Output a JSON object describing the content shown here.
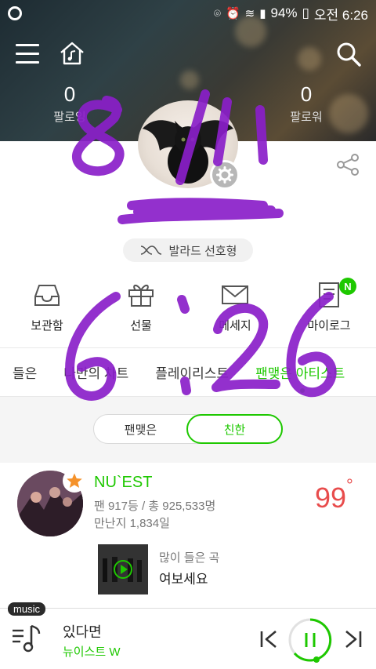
{
  "status_bar": {
    "battery": "94%",
    "time": "오전 6:26"
  },
  "header": {
    "following_count": "0",
    "following_label": "팔로잉",
    "followers_count": "0",
    "followers_label": "팔로워"
  },
  "profile": {
    "tag": "발라드 선호형"
  },
  "actions": [
    {
      "label": "보관함",
      "icon": "inbox-tray-icon"
    },
    {
      "label": "선물",
      "icon": "gift-icon"
    },
    {
      "label": "메세지",
      "icon": "mail-icon"
    },
    {
      "label": "마이로그",
      "icon": "document-icon",
      "badge": "N"
    }
  ],
  "tabs": [
    "들은",
    "나만의 차트",
    "플레이리스트",
    "팬맺은 아티스트"
  ],
  "active_tab": "팬맺은 아티스트",
  "segment": {
    "options": [
      "팬맺은",
      "친한"
    ],
    "selected": "친한"
  },
  "artist": {
    "name": "NU`EST",
    "fan_info": "팬 917등 / 총 925,533명",
    "days": "만난지 1,834일",
    "score": "99",
    "score_unit": "°",
    "most_played_label": "많이 들은 곡",
    "most_played_song": "여보세요"
  },
  "player": {
    "tab_label": "music",
    "track_title": "있다면",
    "track_artist": "뉴이스트 W"
  },
  "colors": {
    "accent": "#1ec800",
    "score": "#e84c4c",
    "scribble": "#8a1fc9"
  }
}
